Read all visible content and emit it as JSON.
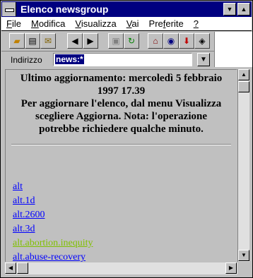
{
  "window": {
    "title": "Elenco newsgroup"
  },
  "icons": {
    "minimize": "minimize-icon",
    "maximize": "maximize-icon",
    "system_menu": "system-menu-icon"
  },
  "menu": [
    {
      "label": "File",
      "accel": "F",
      "rest": "ile"
    },
    {
      "label": "Modifica",
      "accel": "M",
      "rest": "odifica"
    },
    {
      "label": "Visualizza",
      "accel": "V",
      "rest": "isualizza"
    },
    {
      "label": "Vai",
      "accel": "V",
      "rest": "ai"
    },
    {
      "label": "Preferite",
      "pre": "Pre",
      "accel": "f",
      "rest": "erite"
    },
    {
      "label": "?",
      "accel": "?",
      "rest": ""
    }
  ],
  "address": {
    "label": "Indirizzo",
    "value": "news:*"
  },
  "content": {
    "header_lines": [
      "Ultimo aggiornamento: mercoledì 5 febbraio",
      "1997 17.39",
      "Per aggiornare l'elenco, dal menu Visualizza",
      "scegliere Aggiorna. Nota: l'operazione",
      "potrebbe richiedere qualche minuto."
    ],
    "links": [
      {
        "text": "alt",
        "visited": false
      },
      {
        "text": "alt.1d",
        "visited": false
      },
      {
        "text": "alt.2600",
        "visited": false
      },
      {
        "text": "alt.3d",
        "visited": false
      },
      {
        "text": "alt.abortion.inequity",
        "visited": true
      },
      {
        "text": "alt.abuse-recovery",
        "visited": false
      }
    ]
  },
  "colors": {
    "titlebar": "#000080",
    "link": "#0000ff",
    "link_visited": "#80c000",
    "face": "#c0c0c0"
  }
}
